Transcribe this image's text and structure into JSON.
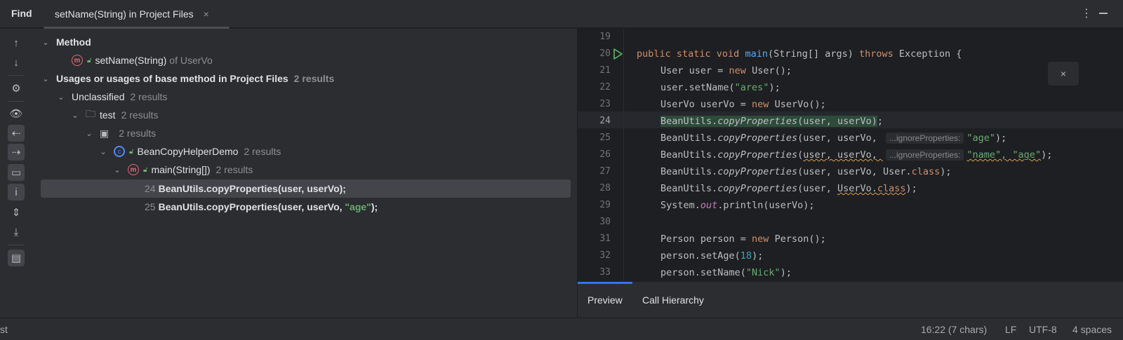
{
  "window": {
    "find_label": "Find",
    "tab_title": "setName(String) in Project Files",
    "tab_close": "×",
    "more_icon": "more-vertical-icon",
    "minimize_icon": "minimize-icon"
  },
  "toolbar": {
    "items": [
      "arrow-up-icon",
      "arrow-down-icon",
      "gear-icon",
      "eye-icon",
      "import-icon",
      "export-icon",
      "folder-filter-icon",
      "info-icon",
      "expand-all-icon",
      "collapse-all-icon",
      "preview-panel-icon"
    ]
  },
  "tree": {
    "method_header": "Method",
    "method_name": "setName(String)",
    "method_of": "of UserVo",
    "usages_header": "Usages or usages of base method in Project Files",
    "usages_count": "2 results",
    "unclassified": "Unclassified",
    "unclassified_count": "2 results",
    "test_folder": "test",
    "test_count": "2 results",
    "pkg_count": "2 results",
    "class_name": "BeanCopyHelperDemo",
    "class_count": "2 results",
    "main_name": "main(String[])",
    "main_count": "2 results",
    "results": [
      {
        "line": "24",
        "code": "BeanUtils.copyProperties(user, userVo);",
        "str": ""
      },
      {
        "line": "25",
        "code": "BeanUtils.copyProperties(user, userVo, ",
        "str": "\"age\"",
        "tail": ");"
      }
    ]
  },
  "editor": {
    "line_numbers": [
      "19",
      "20",
      "21",
      "22",
      "23",
      "24",
      "25",
      "26",
      "27",
      "28",
      "29",
      "30",
      "31",
      "32",
      "33"
    ],
    "close": "×",
    "hint_label": "...ignoreProperties:"
  },
  "bottom_tabs": {
    "preview": "Preview",
    "call_hierarchy": "Call Hierarchy"
  },
  "status": {
    "left": "st",
    "position": "16:22 (7 chars)",
    "line_ending": "LF",
    "encoding": "UTF-8",
    "indent": "4 spaces"
  },
  "colors": {
    "accent": "#3574f0",
    "string": "#6aab73",
    "keyword": "#cf8e6d"
  }
}
